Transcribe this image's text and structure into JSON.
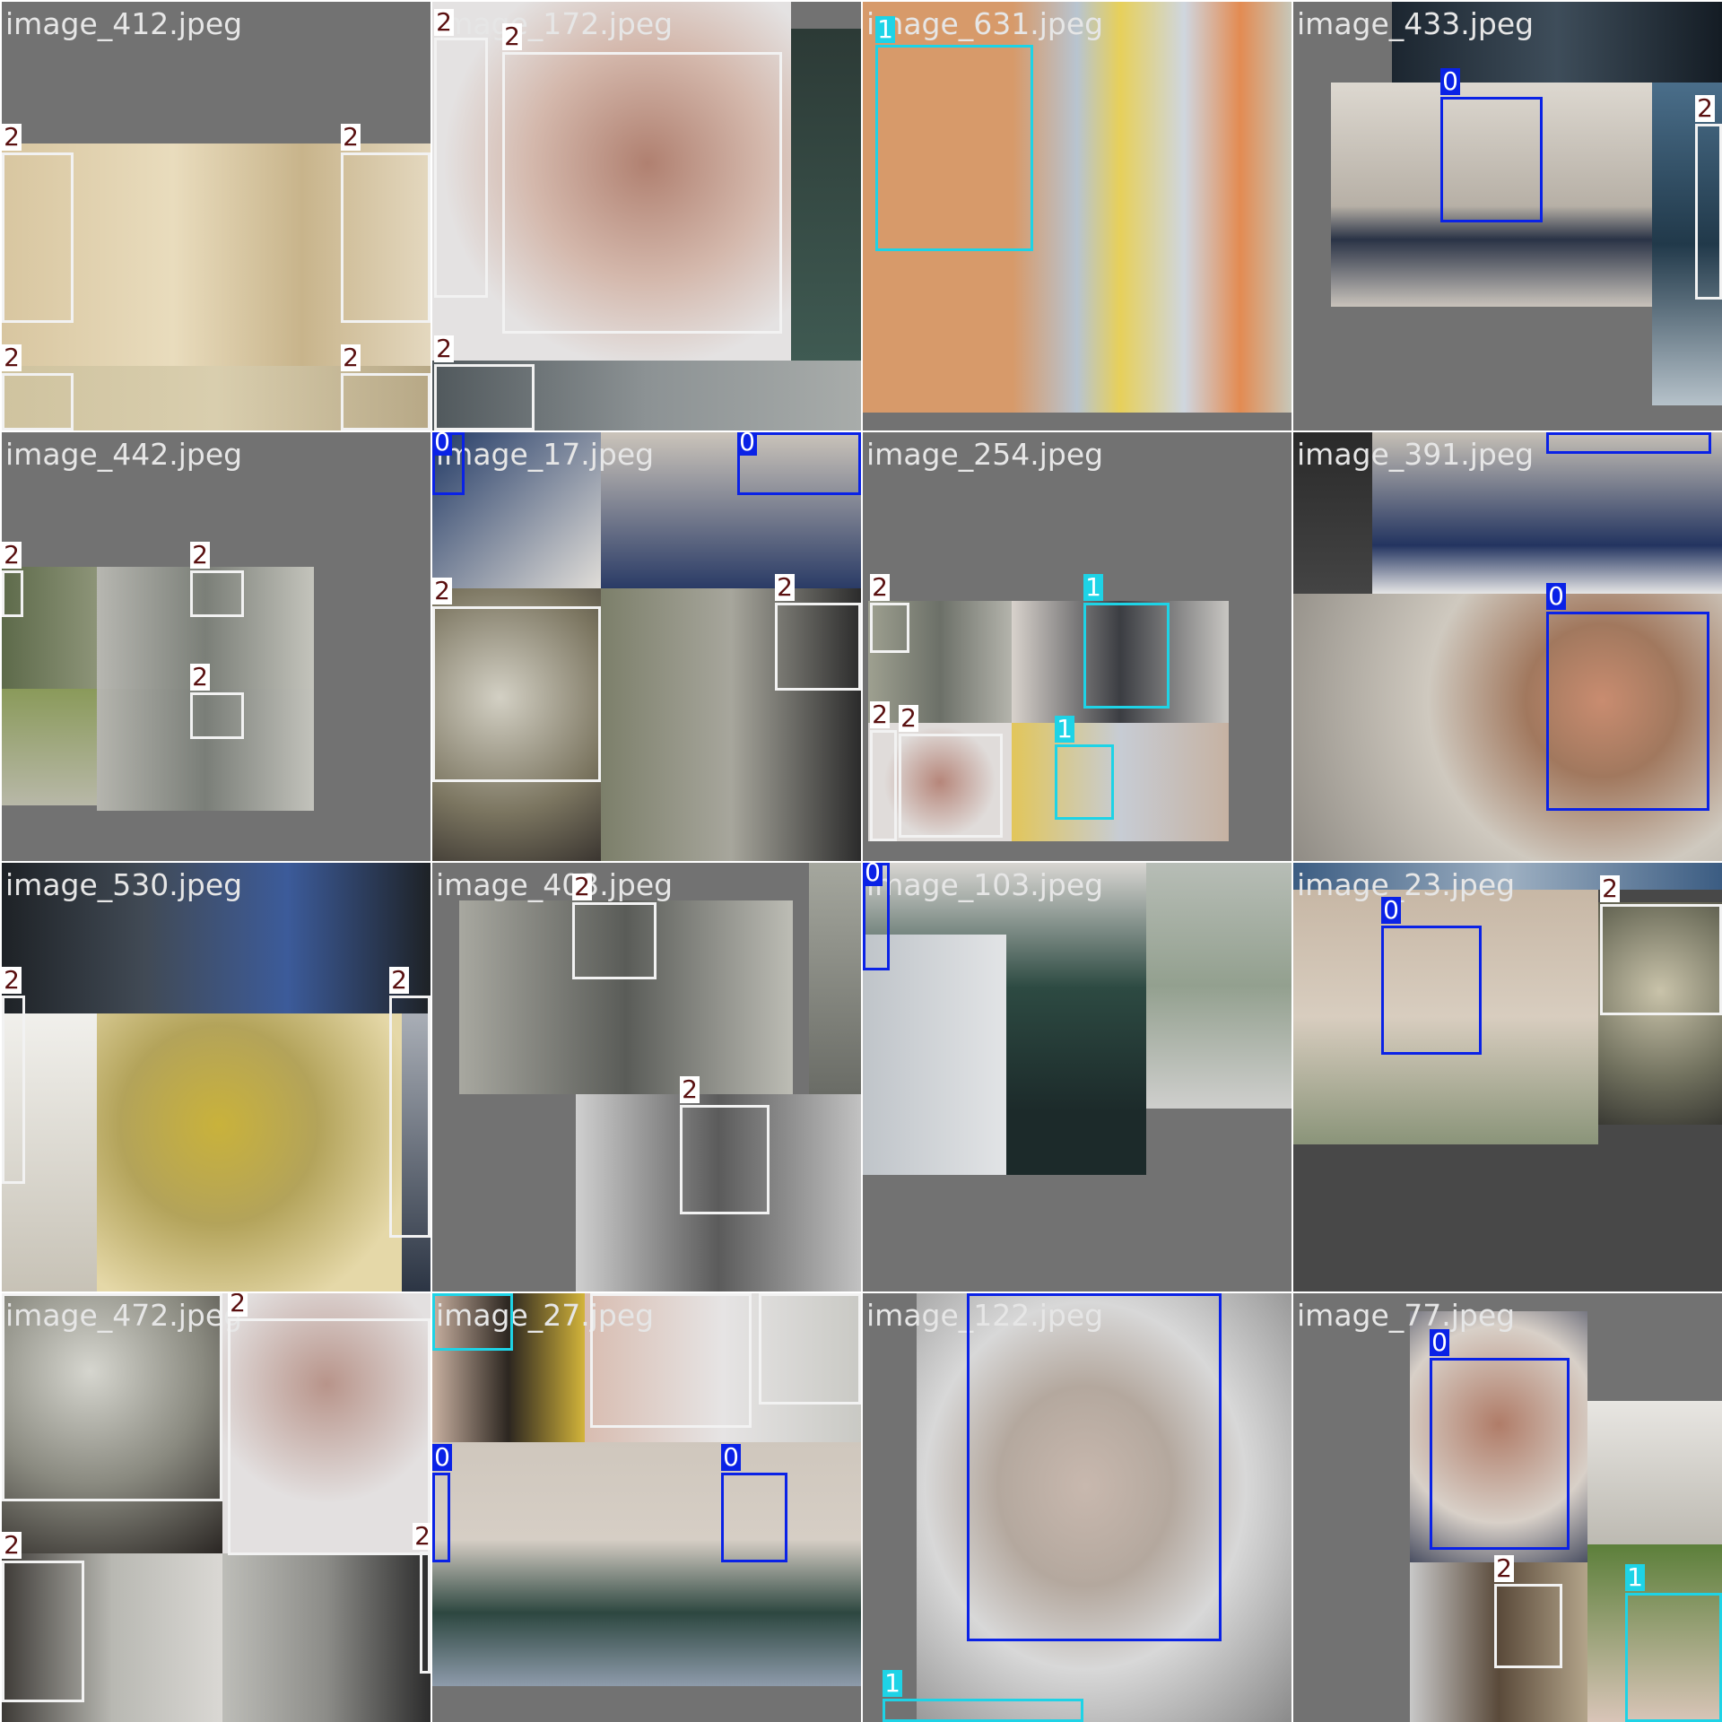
{
  "class_colors": {
    "0": "#0a22e6",
    "1": "#1ed3e6",
    "2": "#f2f2f2"
  },
  "tiles": [
    {
      "filename": "image_412.jpeg",
      "labels": [
        "2",
        "2",
        "2",
        "2"
      ]
    },
    {
      "filename": "image_172.jpeg",
      "labels": [
        "2",
        "2",
        "2"
      ]
    },
    {
      "filename": "image_631.jpeg",
      "labels": [
        "1"
      ]
    },
    {
      "filename": "image_433.jpeg",
      "labels": [
        "0",
        "2"
      ]
    },
    {
      "filename": "image_442.jpeg",
      "labels": [
        "2",
        "2",
        "2"
      ]
    },
    {
      "filename": "image_17.jpeg",
      "labels": [
        "0",
        "0",
        "2",
        "2"
      ]
    },
    {
      "filename": "image_254.jpeg",
      "labels": [
        "2",
        "1",
        "2",
        "2",
        "1"
      ]
    },
    {
      "filename": "image_391.jpeg",
      "labels": [
        "0",
        "0"
      ]
    },
    {
      "filename": "image_530.jpeg",
      "labels": [
        "2",
        "2"
      ]
    },
    {
      "filename": "image_403.jpeg",
      "labels": [
        "2",
        "2"
      ]
    },
    {
      "filename": "image_103.jpeg",
      "labels": [
        "0"
      ]
    },
    {
      "filename": "image_23.jpeg",
      "labels": [
        "0",
        "2"
      ]
    },
    {
      "filename": "image_472.jpeg",
      "labels": [
        "2",
        "2",
        "2",
        "2"
      ]
    },
    {
      "filename": "image_27.jpeg",
      "labels": [
        "1",
        "2",
        "2",
        "0",
        "0"
      ]
    },
    {
      "filename": "image_122.jpeg",
      "labels": [
        "0",
        "1"
      ]
    },
    {
      "filename": "image_77.jpeg",
      "labels": [
        "0",
        "2",
        "1"
      ]
    }
  ]
}
